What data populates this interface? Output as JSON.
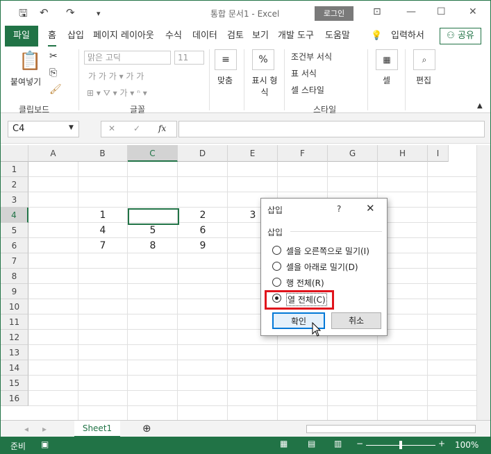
{
  "window": {
    "title": "통합 문서1  -  Excel",
    "login": "로그인"
  },
  "tabs": {
    "file": "파일",
    "items": [
      "홈",
      "삽입",
      "페이지 레이아웃",
      "수식",
      "데이터",
      "검토",
      "보기",
      "개발 도구",
      "도움말"
    ],
    "tell": "입력하서",
    "share": "공유"
  },
  "ribbon": {
    "paste": "붙여넣기",
    "clipboard": "클립보드",
    "font_name": "맑은 고딕",
    "font_size": "11",
    "font_group": "글꼴",
    "align": "맞춤",
    "number": "표시 형식",
    "cond": "조건부 서식",
    "table": "표 서식",
    "cellstyle": "셀 스타일",
    "style_group": "스타일",
    "cells": "셀",
    "edit": "편집"
  },
  "formula": {
    "namebox": "C4",
    "fx": "fx"
  },
  "columns": [
    "A",
    "B",
    "C",
    "D",
    "E",
    "F",
    "G",
    "H",
    "I"
  ],
  "rows": [
    "1",
    "2",
    "3",
    "4",
    "5",
    "6",
    "7",
    "8",
    "9",
    "10",
    "11",
    "12",
    "13",
    "14",
    "15",
    "16"
  ],
  "cells": {
    "B4": "1",
    "D4": "2",
    "E4": "3",
    "B5": "4",
    "C5": "5",
    "D5": "6",
    "B6": "7",
    "C6": "8",
    "D6": "9"
  },
  "sheet": {
    "name": "Sheet1"
  },
  "status": {
    "ready": "준비",
    "zoom": "100%"
  },
  "dialog": {
    "title": "삽입",
    "help": "?",
    "group": "삽입",
    "options": [
      "셀을 오른쪽으로 밀기(I)",
      "셀을 아래로 밀기(D)",
      "행 전체(R)",
      "열 전체(C)"
    ],
    "selected": 3,
    "ok": "확인",
    "cancel": "취소"
  },
  "colors": {
    "accent": "#217346",
    "highlight": "#e0141c"
  }
}
